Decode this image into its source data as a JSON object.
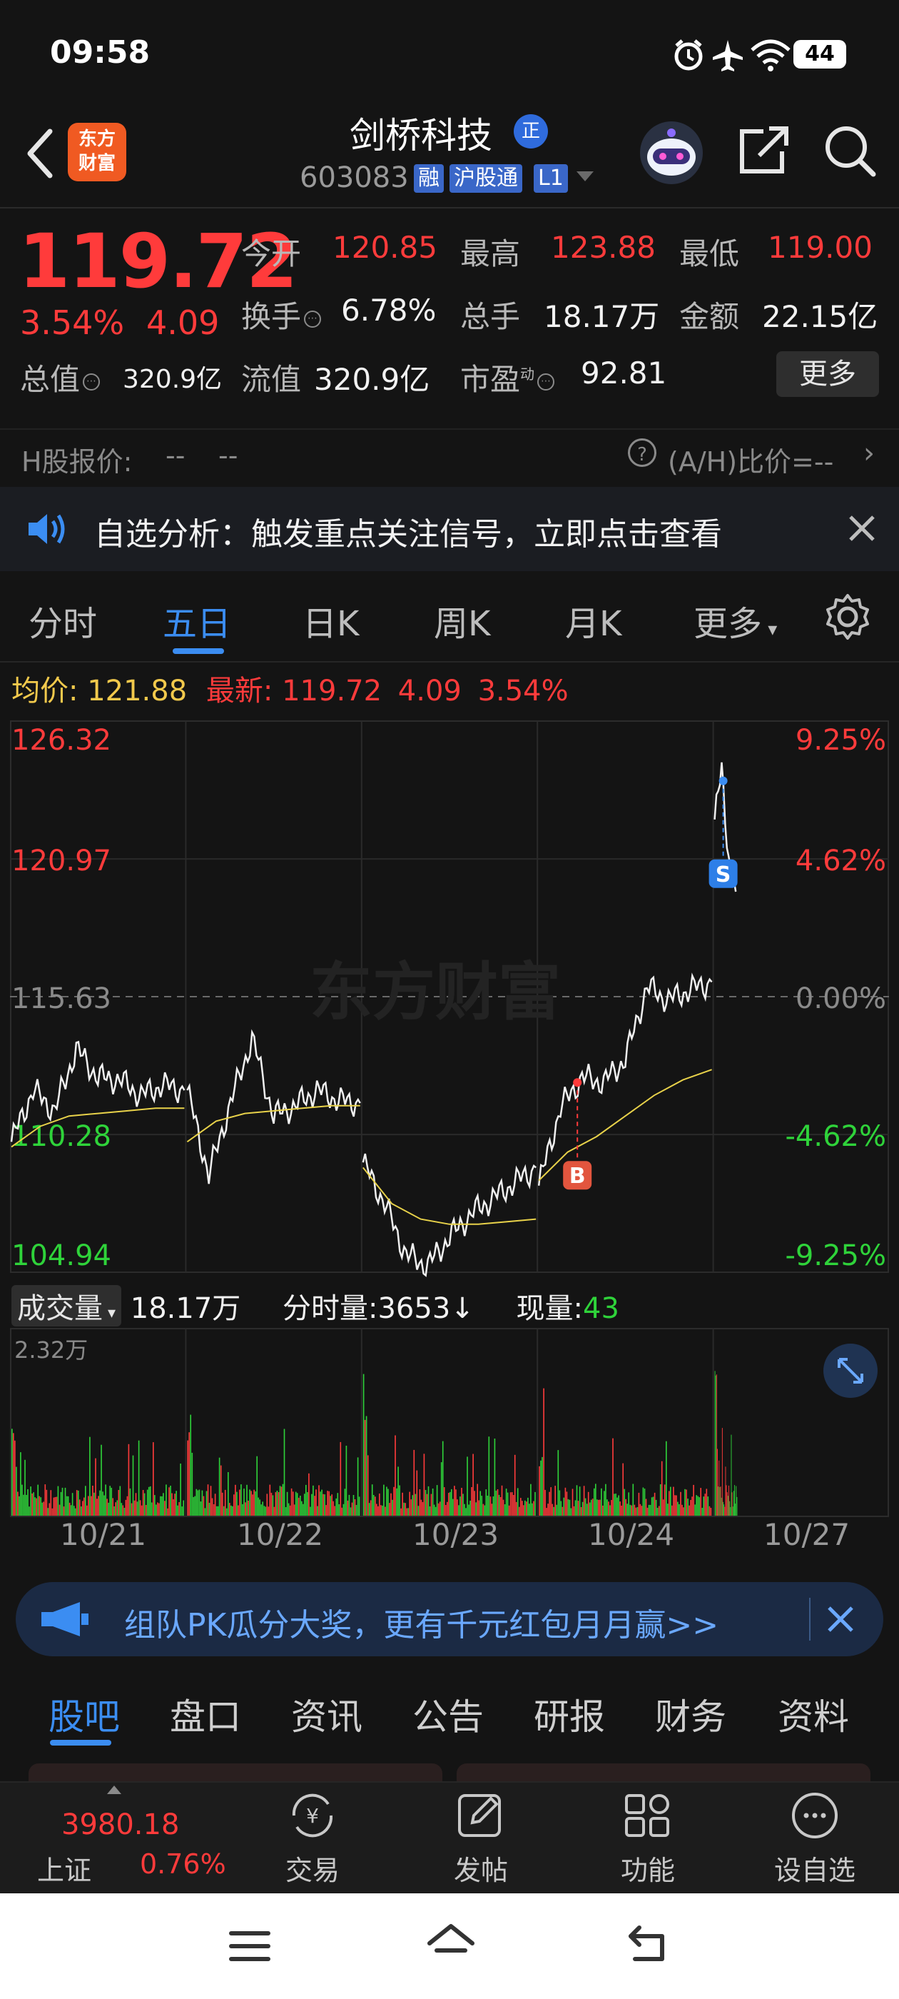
{
  "status_bar": {
    "time": "09:58",
    "battery": "44"
  },
  "header": {
    "logo_line1": "东方",
    "logo_line2": "财富",
    "stock_name": "剑桥科技",
    "badge": "正",
    "stock_code": "603083",
    "tags": [
      "融",
      "沪股通",
      "L1"
    ]
  },
  "quote": {
    "price": "119.72",
    "change_pct": "3.54%",
    "change": "4.09",
    "open_label": "今开",
    "open": "120.85",
    "high_label": "最高",
    "high": "123.88",
    "low_label": "最低",
    "low": "119.00",
    "turnover_label": "换手",
    "turnover": "6.78%",
    "volume_label": "总手",
    "volume": "18.17万",
    "amount_label": "金额",
    "amount": "22.15亿",
    "mktcap_label": "总值",
    "mktcap": "320.9亿",
    "float_label": "流值",
    "float": "320.9亿",
    "pe_label": "市盈",
    "pe_sup": "动",
    "pe": "92.81",
    "more": "更多"
  },
  "h_share": {
    "label": "H股报价:",
    "v1": "--",
    "v2": "--",
    "ratio": "(A/H)比价=--"
  },
  "notice": {
    "text": "自选分析：触发重点关注信号，立即点击查看"
  },
  "tabs": [
    "分时",
    "五日",
    "日K",
    "周K",
    "月K",
    "更多"
  ],
  "active_tab": "五日",
  "avg_row": {
    "avg_label": "均价:",
    "avg": "121.88",
    "latest_label": "最新:",
    "latest": "119.72",
    "change": "4.09",
    "pct": "3.54%"
  },
  "chart_data": {
    "type": "line",
    "title": "",
    "x": [
      "10/21",
      "10/22",
      "10/23",
      "10/24",
      "10/27"
    ],
    "y_left_ticks": [
      "126.32",
      "120.97",
      "115.63",
      "110.28",
      "104.94"
    ],
    "y_right_ticks": [
      "9.25%",
      "4.62%",
      "0.00%",
      "-4.62%",
      "-9.25%"
    ],
    "ylim": [
      104.94,
      126.32
    ],
    "prev_close": 115.63,
    "series": [],
    "markers": [
      {
        "label": "B",
        "day": "10/24"
      },
      {
        "label": "S",
        "day": "10/27"
      }
    ],
    "watermark": "东方财富"
  },
  "volume": {
    "label": "成交量",
    "total": "18.17万",
    "tick_label": "分时量:",
    "tick_value": "3653",
    "tick_arrow": "↓",
    "now_label": "现量:",
    "now_value": "43",
    "ymax_label": "2.32万"
  },
  "dates": [
    "10/21",
    "10/22",
    "10/23",
    "10/24",
    "10/27"
  ],
  "ad": {
    "text": "组队PK瓜分大奖，更有千元红包月月赢>>"
  },
  "sub_tabs": [
    "股吧",
    "盘口",
    "资讯",
    "公告",
    "研报",
    "财务",
    "资料"
  ],
  "toolbar": {
    "index_value": "3980.18",
    "index_name": "上证",
    "index_pct": "0.76%",
    "trade": "交易",
    "post": "发帖",
    "func": "功能",
    "add": "设自选"
  }
}
